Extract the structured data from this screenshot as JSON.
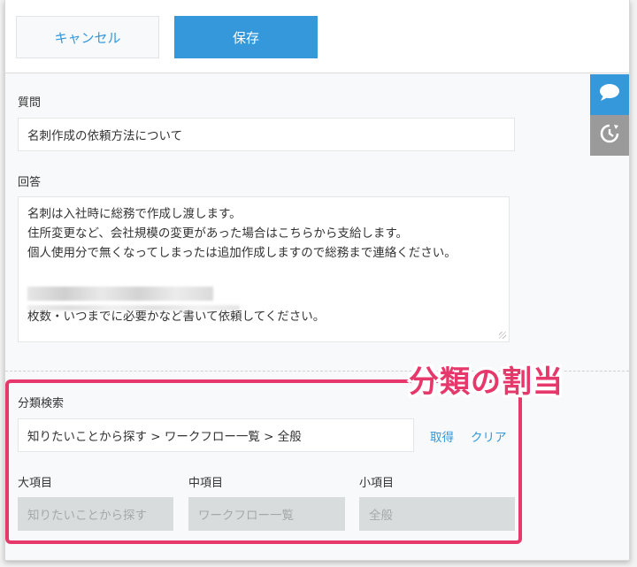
{
  "toolbar": {
    "cancel_label": "キャンセル",
    "save_label": "保存"
  },
  "question": {
    "label": "質問",
    "value": "名刺作成の依頼方法について"
  },
  "answer": {
    "label": "回答",
    "lines": [
      "名刺は入社時に総務で作成し渡します。",
      "住所変更など、会社規模の変更があった場合はこちらから支給します。",
      "個人使用分で無くなってしまったは追加作成しますので総務まで連絡ください。",
      "枚数・いつまでに必要かなど書いて依頼してください。"
    ]
  },
  "category": {
    "search_label": "分類検索",
    "search_value": "知りたいことから探す > ワークフロー一覧 > 全般",
    "fetch_label": "取得",
    "clear_label": "クリア",
    "large_label": "大項目",
    "large_value": "知りたいことから探す",
    "medium_label": "中項目",
    "medium_value": "ワークフロー一覧",
    "small_label": "小項目",
    "small_value": "全般"
  },
  "annotation": {
    "text": "分類の割当",
    "color": "#e6386b"
  },
  "side_tabs": [
    {
      "icon": "comment-icon",
      "color": "#3498db"
    },
    {
      "icon": "history-icon",
      "color": "#9a9a9a"
    }
  ],
  "colors": {
    "accent": "#3498db",
    "highlight": "#e6386b"
  }
}
